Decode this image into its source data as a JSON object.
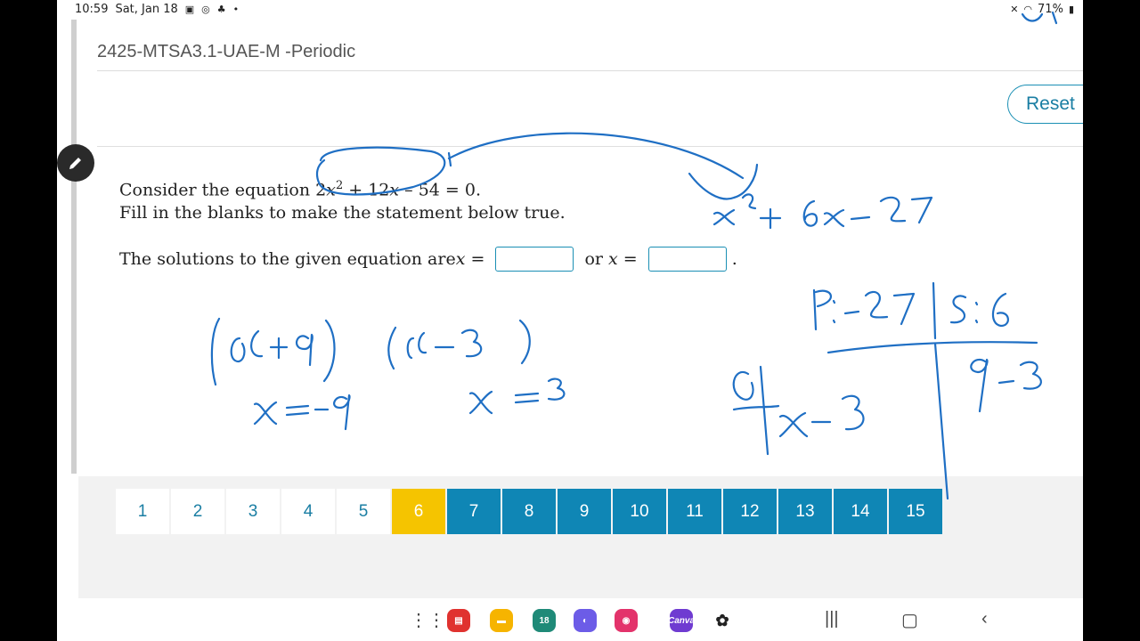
{
  "status_bar": {
    "time": "10:59",
    "date": "Sat, Jan 18",
    "battery": "71%"
  },
  "header": {
    "course_title": "2425-MTSA3.1-UAE-M -Periodic",
    "reset_label": "Reset"
  },
  "question": {
    "line1_prefix": "Consider the equation ",
    "eq_a": "2",
    "eq_var": "x",
    "eq_exp": "2",
    "eq_mid": " + 12",
    "eq_var2": "x",
    "eq_end": " – 54 = 0.",
    "line2": "Fill in the blanks to make the statement below true.",
    "answer_prefix": "The solutions to the given equation are ",
    "var": "x",
    "equals": " = ",
    "or": " or ",
    "period": "."
  },
  "question_nav": {
    "items": [
      "1",
      "2",
      "3",
      "4",
      "5",
      "6",
      "7",
      "8",
      "9",
      "10",
      "11",
      "12",
      "13",
      "14",
      "15"
    ],
    "current": "6"
  },
  "dock": {
    "calendar_day": "18",
    "canva_label": "Canva"
  }
}
